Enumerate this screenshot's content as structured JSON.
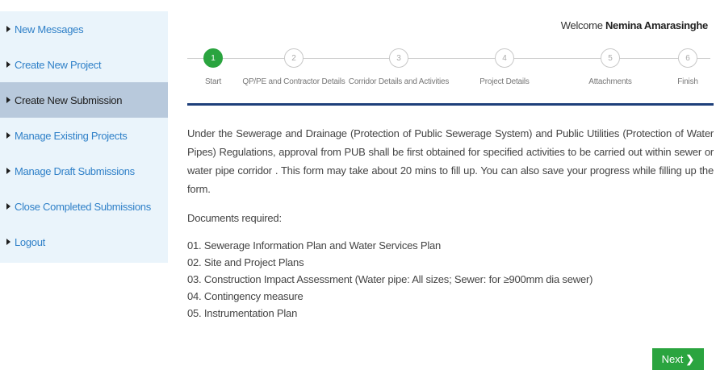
{
  "sidebar": {
    "items": [
      {
        "label": "New Messages"
      },
      {
        "label": "Create New Project"
      },
      {
        "label": "Create New Submission"
      },
      {
        "label": "Manage Existing Projects"
      },
      {
        "label": "Manage Draft Submissions"
      },
      {
        "label": "Close Completed Submissions"
      },
      {
        "label": "Logout"
      }
    ],
    "active_index": 2
  },
  "header": {
    "welcome_prefix": "Welcome",
    "user_name": "Nemina Amarasinghe"
  },
  "stepper": {
    "current_step": 1,
    "steps": [
      {
        "number": "1",
        "label": "Start"
      },
      {
        "number": "2",
        "label": "QP/PE and Contractor Details"
      },
      {
        "number": "3",
        "label": "Corridor Details and Activities"
      },
      {
        "number": "4",
        "label": "Project Details"
      },
      {
        "number": "5",
        "label": "Attachments"
      },
      {
        "number": "6",
        "label": "Finish"
      }
    ]
  },
  "main": {
    "intro": "Under the Sewerage and Drainage (Protection of Public Sewerage System) and Public Utilities (Protection of Water Pipes) Regulations, approval from PUB shall be first obtained for specified activities to be carried out within sewer or water pipe corridor . This form may take about 20 mins to fill up. You can also save your progress while filling up the form.",
    "docs_heading": "Documents required:",
    "documents": [
      "01. Sewerage Information Plan and Water Services Plan",
      "02. Site and Project Plans",
      "03. Construction Impact Assessment (Water pipe: All sizes; Sewer: for ≥900mm dia sewer)",
      "04. Contingency measure",
      "05. Instrumentation Plan"
    ]
  },
  "footer": {
    "next_label": "Next",
    "next_icon": "chevron-right-icon"
  },
  "colors": {
    "accent_green": "#2aa43f",
    "link_blue": "#2f80c8",
    "sidebar_bg": "#eaf4fb",
    "sidebar_active_bg": "#b8c9dc",
    "rule_navy": "#1e3f7a"
  }
}
